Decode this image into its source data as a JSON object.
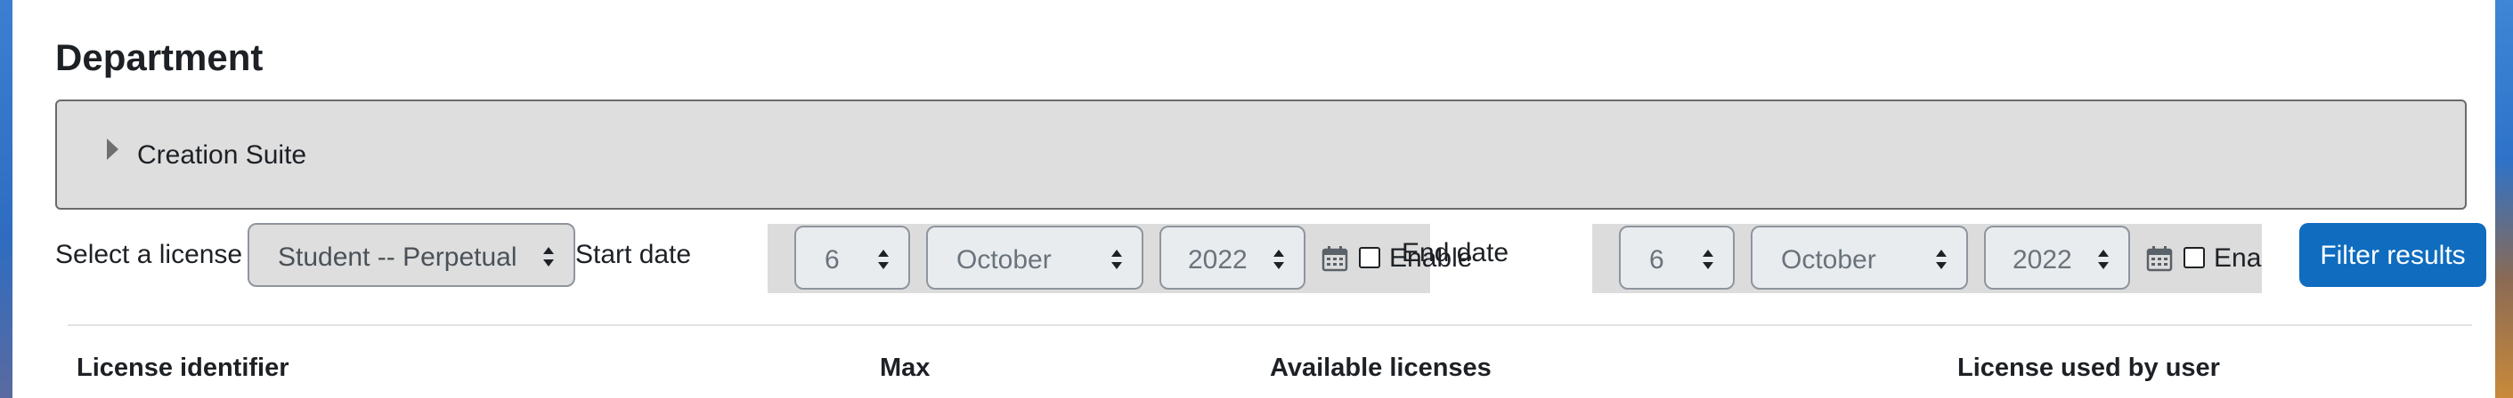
{
  "page": {
    "title": "Department"
  },
  "section": {
    "label": "Creation Suite"
  },
  "filters": {
    "license_label": "Select a license",
    "license_value": "Student -- Perpetual",
    "start_label": "Start date",
    "start": {
      "day": "6",
      "month": "October",
      "year": "2022",
      "enable_label": "Enable"
    },
    "end_label": "End date",
    "end": {
      "day": "6",
      "month": "October",
      "year": "2022",
      "enable_label": "Ena"
    },
    "filter_button": "Filter results"
  },
  "table": {
    "columns": [
      "License identifier",
      "Max",
      "Available licenses",
      "License used by user"
    ]
  },
  "icons": {
    "calendar": "calendar-icon",
    "caret": "caret-right-icon"
  },
  "colors": {
    "primary_button": "#0f6cbf",
    "collapsible_bg": "#dedede"
  }
}
